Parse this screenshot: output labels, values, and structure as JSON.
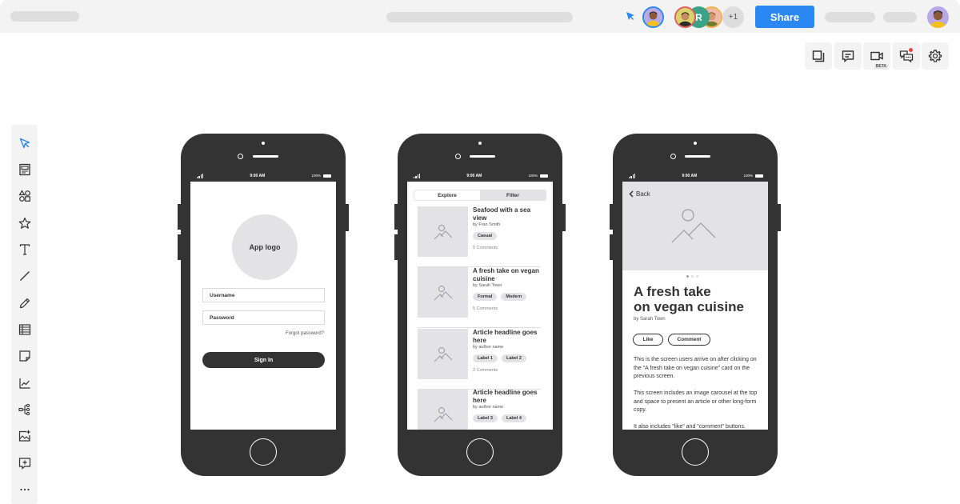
{
  "topbar": {
    "share_label": "Share",
    "collaborators_extra": "+1",
    "collaborator_initial": "R",
    "cursor_color": "#2b87f1",
    "accent": "#2b87f1"
  },
  "right_toolbar": {
    "items": [
      {
        "name": "pages",
        "icon": "pages-icon"
      },
      {
        "name": "comments",
        "icon": "comment-icon"
      },
      {
        "name": "video",
        "icon": "video-icon",
        "badge": "BETA"
      },
      {
        "name": "chat",
        "icon": "chat-icon",
        "notification": true
      },
      {
        "name": "settings",
        "icon": "gear-icon"
      }
    ]
  },
  "left_toolbar": {
    "items": [
      {
        "name": "select",
        "icon": "cursor-icon",
        "active": true
      },
      {
        "name": "templates",
        "icon": "template-icon"
      },
      {
        "name": "shapes",
        "icon": "shapes-icon"
      },
      {
        "name": "stickers",
        "icon": "star-icon"
      },
      {
        "name": "text",
        "icon": "text-icon"
      },
      {
        "name": "line",
        "icon": "line-icon"
      },
      {
        "name": "pen",
        "icon": "pen-icon"
      },
      {
        "name": "table",
        "icon": "table-icon"
      },
      {
        "name": "sticky-note",
        "icon": "sticky-note-icon"
      },
      {
        "name": "chart",
        "icon": "chart-icon"
      },
      {
        "name": "mind-map",
        "icon": "mind-map-icon"
      },
      {
        "name": "image",
        "icon": "image-add-icon"
      },
      {
        "name": "comment",
        "icon": "comment-add-icon"
      },
      {
        "name": "more",
        "icon": "more-icon"
      }
    ]
  },
  "status_bar": {
    "time": "9:00 AM",
    "battery": "100%"
  },
  "phone_login": {
    "logo_label": "App logo",
    "username_placeholder": "Username",
    "password_placeholder": "Password",
    "forgot_label": "Forgot password?",
    "signin_label": "Sign In"
  },
  "phone_list": {
    "tabs": [
      "Explore",
      "Filter"
    ],
    "active_tab": "Explore",
    "cards": [
      {
        "title": "Seafood with a sea view",
        "author": "by Fran Smith",
        "tags": [
          "Casual"
        ],
        "comments": "5 Comments"
      },
      {
        "title": "A fresh take on vegan cuisine",
        "author": "by Sarah Town",
        "tags": [
          "Formal",
          "Modern"
        ],
        "comments": "5 Comments"
      },
      {
        "title": "Article headline goes here",
        "author": "by author name",
        "tags": [
          "Label 1",
          "Label 2"
        ],
        "comments": "2 Comments"
      },
      {
        "title": "Article headline goes here",
        "author": "by author name",
        "tags": [
          "Label 3",
          "Label 4"
        ],
        "comments": ""
      }
    ]
  },
  "phone_detail": {
    "back_label": "Back",
    "title_line1": "A fresh take",
    "title_line2": "on vegan cuisine",
    "author": "by Sarah Town",
    "like_label": "Like",
    "comment_label": "Comment",
    "carousel_pages": 3,
    "carousel_active": 1,
    "body": [
      "This is the screen users arrive on after clicking on the \"A fresh take on vegan cuisine\" card on the previous screen.",
      "This screen includes an image carousel at the top and space to present an article or other long-form copy.",
      "It also includes \"like\" and \"comment\" buttons."
    ]
  }
}
